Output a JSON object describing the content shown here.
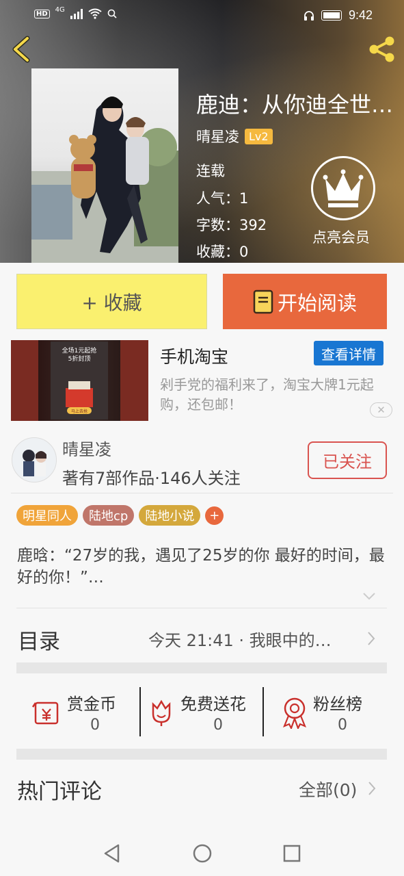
{
  "status_bar": {
    "network": "HD",
    "net_type": "4G",
    "time": "9:42"
  },
  "book": {
    "title": "鹿迪：从你迪全世…",
    "author": "晴星凌",
    "level": "Lv2",
    "status": "连载",
    "popularity": "人气：1",
    "word_count": "字数：392",
    "favorites": "收藏：0"
  },
  "vip": {
    "label": "点亮会员"
  },
  "actions": {
    "collect": "+ 收藏",
    "read": "开始阅读"
  },
  "ad": {
    "title": "手机淘宝",
    "detail_button": "查看详情",
    "description": "剁手党的福利来了，淘宝大牌1元起购，还包邮！",
    "banner_text_1": "全场1元起抢",
    "banner_text_2": "5折封顶",
    "banner_button": "马上去抢"
  },
  "author_card": {
    "name": "晴星凌",
    "stats": "著有7部作品·146人关注",
    "follow_label": "已关注"
  },
  "tags": [
    {
      "label": "明星同人",
      "color": "#f0a43a"
    },
    {
      "label": "陆地cp",
      "color": "#c0766a"
    },
    {
      "label": "陆地小说",
      "color": "#d4a83c"
    }
  ],
  "tag_add": "+",
  "synopsis": "鹿晗：“27岁的我，遇见了25岁的你 最好的时间，最好的你！”…",
  "catalog": {
    "title": "目录",
    "latest": "今天 21:41 · 我眼中的…"
  },
  "stats": [
    {
      "label": "赏金币",
      "value": "0",
      "icon": "reward-coin-icon"
    },
    {
      "label": "免费送花",
      "value": "0",
      "icon": "flower-icon"
    },
    {
      "label": "粉丝榜",
      "value": "0",
      "icon": "medal-icon"
    }
  ],
  "comments": {
    "title": "热门评论",
    "all": "全部(0)"
  },
  "colors": {
    "accent": "#e8683d",
    "collect_bg": "#faf06f",
    "ad_blue": "#1976d2",
    "follow_red": "#d9534f"
  }
}
